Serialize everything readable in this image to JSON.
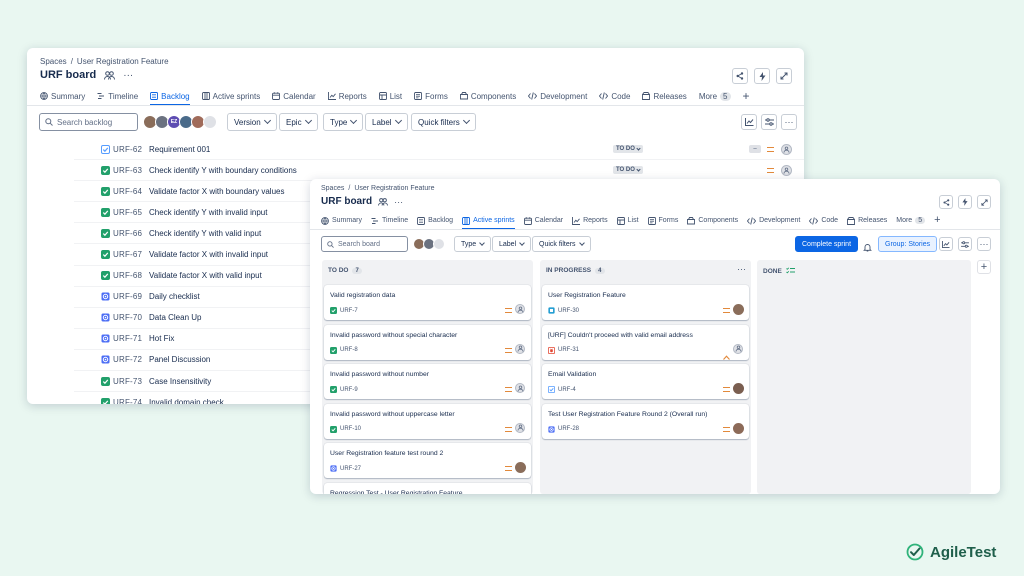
{
  "back_window": {
    "breadcrumbs": [
      "Spaces",
      "/",
      "User Registration Feature"
    ],
    "title": "URF board",
    "tabs": [
      {
        "label": "Summary",
        "icon": "globe-icon"
      },
      {
        "label": "Timeline",
        "icon": "timeline-icon"
      },
      {
        "label": "Backlog",
        "icon": "backlog-icon",
        "active": true
      },
      {
        "label": "Active sprints",
        "icon": "board-icon"
      },
      {
        "label": "Calendar",
        "icon": "calendar-icon"
      },
      {
        "label": "Reports",
        "icon": "chart-icon"
      },
      {
        "label": "List",
        "icon": "list-icon"
      },
      {
        "label": "Forms",
        "icon": "forms-icon"
      },
      {
        "label": "Components",
        "icon": "components-icon"
      },
      {
        "label": "Development",
        "icon": "code-icon"
      },
      {
        "label": "Code",
        "icon": "code-icon"
      },
      {
        "label": "Releases",
        "icon": "releases-icon"
      },
      {
        "label": "More",
        "icon": "",
        "count": "5"
      }
    ],
    "search_placeholder": "Search backlog",
    "avatar_initials": "EZ",
    "filters": [
      "Version",
      "Epic",
      "Type",
      "Label",
      "Quick filters"
    ],
    "status_label": "TO DO",
    "rows": [
      {
        "key": "URF-62",
        "summary": "Requirement 001",
        "type": "test",
        "status": true,
        "dash": true
      },
      {
        "key": "URF-63",
        "summary": "Check identify Y with boundary conditions",
        "type": "story",
        "status": true
      },
      {
        "key": "URF-64",
        "summary": "Validate factor X with boundary values",
        "type": "story"
      },
      {
        "key": "URF-65",
        "summary": "Check identify Y with invalid input",
        "type": "story"
      },
      {
        "key": "URF-66",
        "summary": "Check identify Y with valid input",
        "type": "story"
      },
      {
        "key": "URF-67",
        "summary": "Validate factor X with invalid input",
        "type": "story"
      },
      {
        "key": "URF-68",
        "summary": "Validate factor X with valid input",
        "type": "story"
      },
      {
        "key": "URF-69",
        "summary": "Daily checklist",
        "type": "session"
      },
      {
        "key": "URF-70",
        "summary": "Data Clean Up",
        "type": "session"
      },
      {
        "key": "URF-71",
        "summary": "Hot Fix",
        "type": "session"
      },
      {
        "key": "URF-72",
        "summary": "Panel Discussion",
        "type": "session"
      },
      {
        "key": "URF-73",
        "summary": "Case Insensitivity",
        "type": "story"
      },
      {
        "key": "URF-74",
        "summary": "Invalid domain check",
        "type": "story"
      }
    ]
  },
  "front_window": {
    "breadcrumbs": [
      "Spaces",
      "/",
      "User Registration Feature"
    ],
    "title": "URF board",
    "tabs": [
      {
        "label": "Summary",
        "icon": "globe-icon"
      },
      {
        "label": "Timeline",
        "icon": "timeline-icon"
      },
      {
        "label": "Backlog",
        "icon": "backlog-icon"
      },
      {
        "label": "Active sprints",
        "icon": "board-icon",
        "active": true
      },
      {
        "label": "Calendar",
        "icon": "calendar-icon"
      },
      {
        "label": "Reports",
        "icon": "chart-icon"
      },
      {
        "label": "List",
        "icon": "list-icon"
      },
      {
        "label": "Forms",
        "icon": "forms-icon"
      },
      {
        "label": "Components",
        "icon": "components-icon"
      },
      {
        "label": "Development",
        "icon": "code-icon"
      },
      {
        "label": "Code",
        "icon": "code-icon"
      },
      {
        "label": "Releases",
        "icon": "releases-icon"
      },
      {
        "label": "More",
        "icon": "",
        "count": "5"
      }
    ],
    "search_placeholder": "Search board",
    "filters": [
      "Type",
      "Label",
      "Quick filters"
    ],
    "complete_sprint": "Complete sprint",
    "group_label": "Group: Stories",
    "columns": [
      {
        "name": "TO DO",
        "count": "7",
        "cards": [
          {
            "title": "Valid registration data",
            "key": "URF-7",
            "type": "story",
            "prio": "medium"
          },
          {
            "title": "Invalid password without special character",
            "key": "URF-8",
            "type": "story",
            "prio": "medium"
          },
          {
            "title": "Invalid password without number",
            "key": "URF-9",
            "type": "story",
            "prio": "medium"
          },
          {
            "title": "Invalid password without uppercase letter",
            "key": "URF-10",
            "type": "story",
            "prio": "medium"
          },
          {
            "title": "User Registration feature test round 2",
            "key": "URF-27",
            "type": "session",
            "prio": "medium"
          },
          {
            "title": "Regression Test - User Registration Feature",
            "key": "",
            "type": "",
            "prio": ""
          }
        ]
      },
      {
        "name": "IN PROGRESS",
        "count": "4",
        "cards": [
          {
            "title": "User Registration Feature",
            "key": "URF-30",
            "type": "requirement",
            "prio": "medium"
          },
          {
            "title": "[URF] Couldn't proceed with valid email address",
            "key": "URF-31",
            "type": "bug",
            "prio": "high"
          },
          {
            "title": "Email Validation",
            "key": "URF-4",
            "type": "test",
            "prio": "medium"
          },
          {
            "title": "Test User Registration Feature Round 2 (Overall run)",
            "key": "URF-28",
            "type": "session",
            "prio": "medium"
          }
        ]
      },
      {
        "name": "DONE",
        "count": "",
        "cards": []
      }
    ]
  },
  "brand": {
    "name": "AgileTest",
    "color": "#1f5f4b",
    "accent": "#2fb37a"
  },
  "colors": {
    "link": "#0c66e4",
    "story": "#22a06b",
    "session": "#4c6ef5",
    "bug": "#e34935",
    "requirement": "#1d9bd1",
    "test": "#579dff",
    "priority_medium": "#e2893b"
  }
}
